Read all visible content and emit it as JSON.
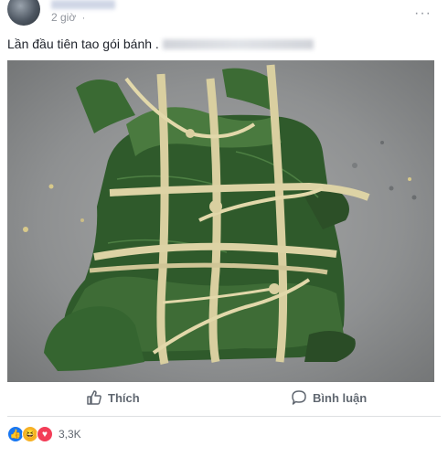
{
  "post": {
    "time": "2 giờ",
    "text": "Lần đầu tiên tao gói bánh .",
    "privacy_icon": "globe-icon"
  },
  "actions": {
    "like_label": "Thích",
    "comment_label": "Bình luận"
  },
  "reactions": {
    "count": "3,3K",
    "types": [
      "like",
      "haha",
      "love"
    ]
  },
  "colors": {
    "leaf": "#2f5a2b",
    "bamboo_strip": "#d9cfa0",
    "background": "#ffffff"
  }
}
